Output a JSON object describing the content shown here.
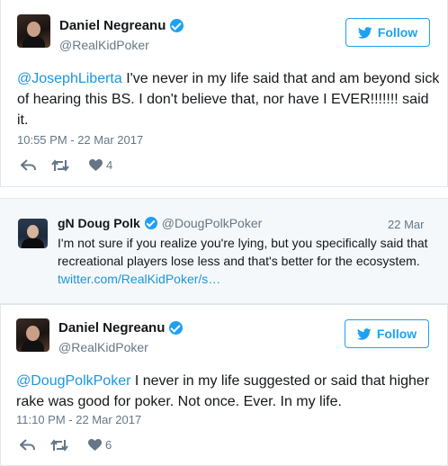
{
  "tweet1": {
    "display_name": "Daniel Negreanu",
    "handle": "@RealKidPoker",
    "follow_label": "Follow",
    "mention": "@JosephLiberta",
    "text": " I've never in my life said that and am beyond sick of hearing this BS. I don't believe that, nor have I EVER!!!!!!! said it.",
    "timestamp": "10:55 PM - 22 Mar 2017",
    "like_count": "4"
  },
  "quote": {
    "display_name": "gN Doug Polk",
    "handle": "@DougPolkPoker",
    "date": "22 Mar",
    "text": "I'm not sure if you realize you're lying, but you specifically said that recreational players lose less and that's better for the ecosystem. ",
    "link": "twitter.com/RealKidPoker/s…"
  },
  "tweet2": {
    "display_name": "Daniel Negreanu",
    "handle": "@RealKidPoker",
    "follow_label": "Follow",
    "mention": "@DougPolkPoker",
    "text": " I never in my life suggested or said that higher rake was good for poker. Not once. Ever. In my life.",
    "timestamp": "11:10 PM - 22 Mar 2017",
    "like_count": "6"
  },
  "colors": {
    "accent": "#1da1f2",
    "link": "#1b95e0",
    "muted": "#657786",
    "quote_bg": "#f5f8fa"
  },
  "icons": [
    "verified-icon",
    "twitter-bird-icon",
    "reply-icon",
    "retweet-icon",
    "heart-icon"
  ]
}
